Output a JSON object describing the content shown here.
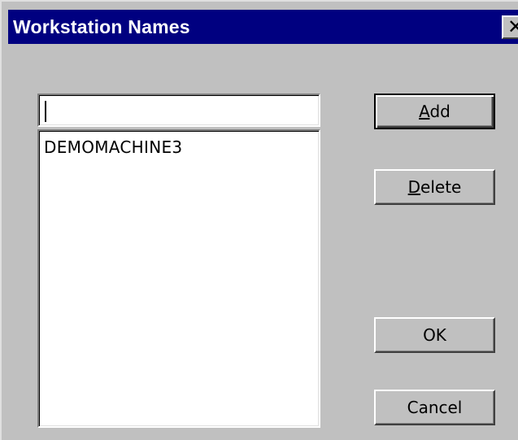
{
  "window": {
    "title": "Workstation Names",
    "close_glyph": "✕",
    "close_icon": "close-icon"
  },
  "input": {
    "value": ""
  },
  "list": {
    "items": [
      "DEMOMACHINE3"
    ]
  },
  "buttons": {
    "add": {
      "mnemonic": "A",
      "rest": "dd"
    },
    "delete": {
      "mnemonic": "D",
      "rest": "elete"
    },
    "ok": {
      "label": "OK"
    },
    "cancel": {
      "label": "Cancel"
    }
  },
  "colors": {
    "titlebar": "#000080",
    "face": "#c0c0c0"
  }
}
